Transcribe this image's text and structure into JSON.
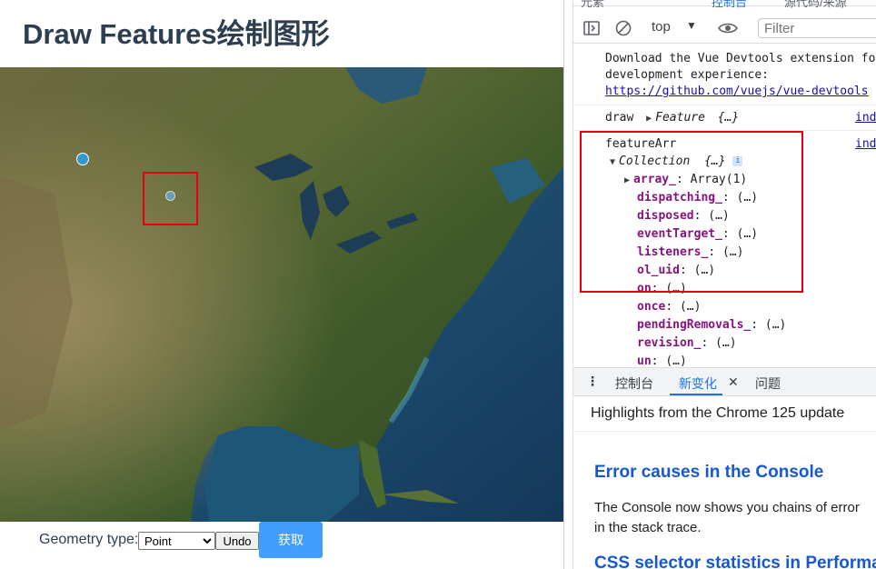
{
  "app": {
    "title": "Draw Features绘制图形",
    "controls": {
      "geometry_label": "Geometry type:",
      "geometry_selected": "Point",
      "undo_label": "Undo",
      "get_label": "获取"
    }
  },
  "devtools": {
    "tabs": [
      "元素",
      "控制台",
      "源代码/来源"
    ],
    "toolbar": {
      "context": "top",
      "filter_placeholder": "Filter"
    },
    "console": {
      "msg1_line1": "Download the Vue Devtools extension fo",
      "msg1_line2": "development experience:",
      "msg1_link": "https://github.com/vuejs/vue-devtools",
      "msg2_label": "draw",
      "msg2_obj": "Feature",
      "msg2_preview": "{…}",
      "msg2_src": "ind",
      "msg3_label": "featureArr",
      "msg3_src": "ind",
      "collection_name": "Collection",
      "collection_preview": "{…}",
      "info_badge": "i",
      "props": [
        {
          "key": "array_",
          "value": "Array(1)"
        },
        {
          "key": "dispatching_",
          "value": "(…)"
        },
        {
          "key": "disposed",
          "value": "(…)"
        },
        {
          "key": "eventTarget_",
          "value": "(…)"
        },
        {
          "key": "listeners_",
          "value": "(…)"
        },
        {
          "key": "ol_uid",
          "value": "(…)"
        },
        {
          "key": "on",
          "value": "(…)"
        },
        {
          "key": "once",
          "value": "(…)"
        },
        {
          "key": "pendingRemovals_",
          "value": "(…)"
        },
        {
          "key": "revision_",
          "value": "(…)"
        },
        {
          "key": "un",
          "value": "(…)"
        }
      ]
    },
    "drawer": {
      "tabs": [
        "控制台",
        "新变化",
        "问题"
      ],
      "highlight": "Highlights from the Chrome 125 update",
      "heading1": "Error causes in the Console",
      "para_line1": "The Console now shows you chains of error",
      "para_line2": "in the stack trace.",
      "heading2": "CSS selector statistics in Performan"
    }
  },
  "colors": {
    "accent_blue": "#409eff",
    "red_highlight": "#e60012",
    "devtools_link": "#1a73e8"
  }
}
